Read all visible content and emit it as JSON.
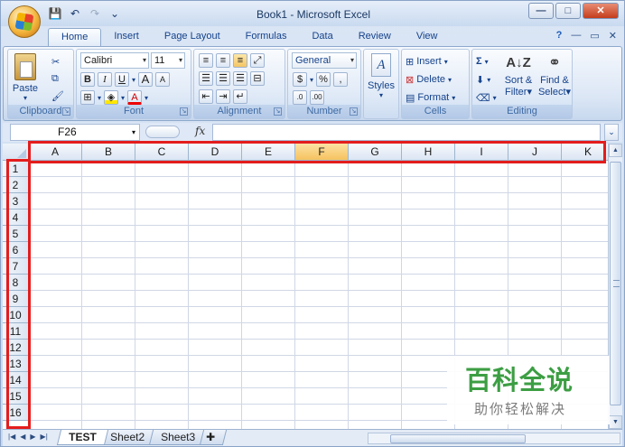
{
  "window": {
    "title": "Book1 - Microsoft Excel",
    "controls": [
      "—",
      "□",
      "✕"
    ]
  },
  "qat": {
    "save_icon": "save-icon",
    "undo_icon": "undo-icon",
    "redo_icon": "redo-icon"
  },
  "tabs": [
    {
      "label": "Home"
    },
    {
      "label": "Insert"
    },
    {
      "label": "Page Layout"
    },
    {
      "label": "Formulas"
    },
    {
      "label": "Data"
    },
    {
      "label": "Review"
    },
    {
      "label": "View"
    }
  ],
  "ribbon": {
    "clipboard": {
      "paste": "Paste",
      "label": "Clipboard"
    },
    "font": {
      "family": "Calibri",
      "size": "11",
      "bold": "B",
      "italic": "I",
      "underline": "U",
      "grow": "A",
      "shrink": "A",
      "fontcolor": "A",
      "label": "Font"
    },
    "alignment": {
      "label": "Alignment"
    },
    "number": {
      "format": "General",
      "percent": "%",
      "comma": ",",
      "label": "Number"
    },
    "styles": {
      "label": "Styles"
    },
    "cells": {
      "insert": "Insert",
      "delete": "Delete",
      "format": "Format",
      "label": "Cells"
    },
    "editing": {
      "sort": "Sort &",
      "sort2": "Filter",
      "find": "Find &",
      "find2": "Select",
      "label": "Editing"
    }
  },
  "formula_bar": {
    "name_box": "F26",
    "fx": "fx",
    "value": ""
  },
  "columns": [
    "A",
    "B",
    "C",
    "D",
    "E",
    "F",
    "G",
    "H",
    "I",
    "J",
    "K"
  ],
  "selected_column": "F",
  "rows": [
    "1",
    "2",
    "3",
    "4",
    "5",
    "6",
    "7",
    "8",
    "9",
    "10",
    "11",
    "12",
    "13",
    "14",
    "15",
    "16"
  ],
  "sheets": [
    {
      "name": "TEST",
      "active": true
    },
    {
      "name": "Sheet2"
    },
    {
      "name": "Sheet3"
    }
  ],
  "watermark": {
    "line1": "百科全说",
    "line2": "助你轻松解决"
  }
}
